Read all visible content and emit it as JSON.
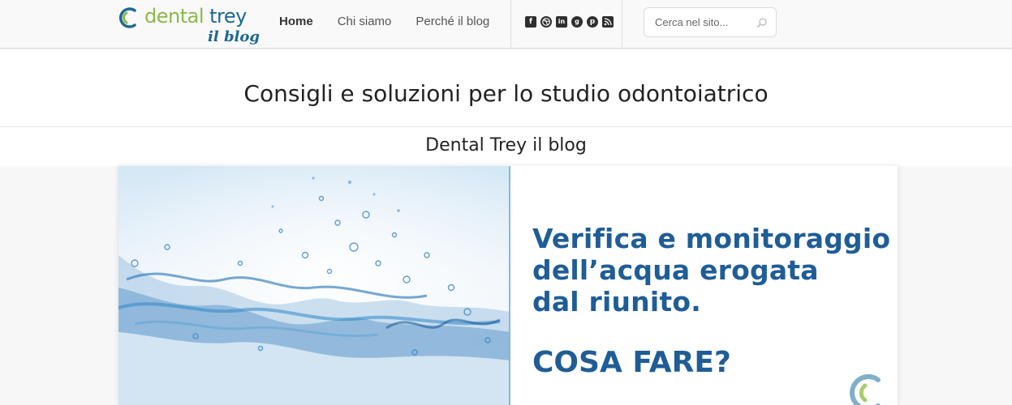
{
  "header": {
    "logo": {
      "word1": "dental",
      "word2": "trey",
      "subtitle": "il blog"
    },
    "nav": [
      {
        "label": "Home",
        "active": true
      },
      {
        "label": "Chi siamo",
        "active": false
      },
      {
        "label": "Perché il blog",
        "active": false
      }
    ],
    "social_icons": [
      "facebook-icon",
      "dribbble-icon",
      "linkedin-icon",
      "google-plus-icon",
      "pinterest-icon",
      "rss-icon"
    ],
    "search": {
      "placeholder": "Cerca nel sito...",
      "value": ""
    }
  },
  "tagline": "Consigli e soluzioni per lo studio odontoiatrico",
  "site_title": "Dental Trey il blog",
  "banner": {
    "lines": [
      "Verifica e monitoraggio",
      "dell’acqua erogata",
      "dal riunito."
    ],
    "cta": "COSA FARE?"
  },
  "colors": {
    "brand_green": "#8bb84a",
    "brand_blue": "#1d6891",
    "banner_text": "#1f5d96",
    "header_bg": "#f9f9f9",
    "page_bg": "#f7f7f7"
  }
}
